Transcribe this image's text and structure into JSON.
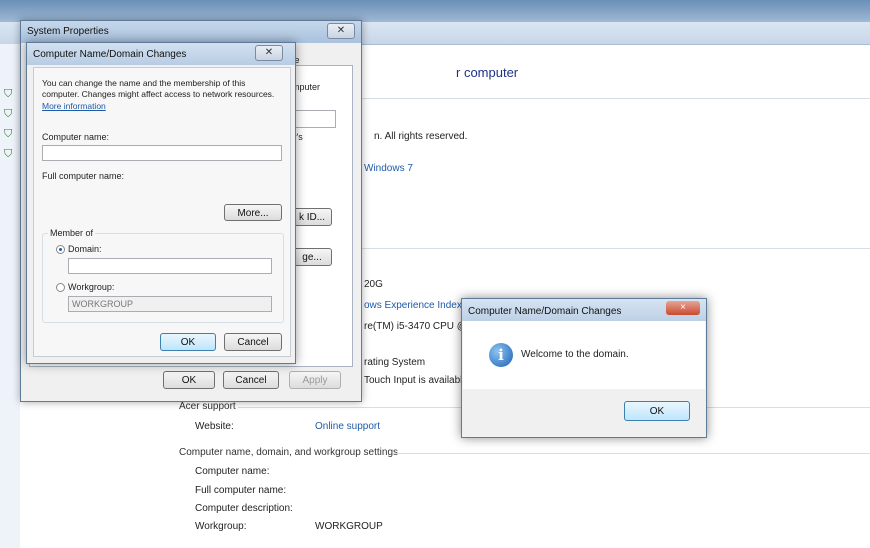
{
  "background": {
    "heading": "r computer",
    "copyright": "n.  All rights reserved.",
    "windows7_link": "Windows 7",
    "processor_line_1": "20G",
    "experience_index_link": "ows Experience Index",
    "processor_line_2": "re(TM) i5-3470 CPU @ 3",
    "os_type": "rating System",
    "touch_input": "Touch Input is available",
    "acer_support_title": "Acer support",
    "website_label": "Website:",
    "website_link": "Online support",
    "name_section_title": "Computer name, domain, and workgroup settings",
    "rows": [
      {
        "label": "Computer name:",
        "value": ""
      },
      {
        "label": "Full computer name:",
        "value": ""
      },
      {
        "label": "Computer description:",
        "value": ""
      },
      {
        "label": "Workgroup:",
        "value": "WORKGROUP"
      }
    ]
  },
  "system_properties": {
    "title": "System Properties",
    "tab_fragment": "ote",
    "panel_text": {
      "computer": "mputer",
      "ys": "y's",
      "network_id_button": "k ID...",
      "change_button": "ge..."
    },
    "buttons": {
      "ok": "OK",
      "cancel": "Cancel",
      "apply": "Apply"
    }
  },
  "name_dialog": {
    "title": "Computer Name/Domain Changes",
    "description": "You can change the name and the membership of this computer. Changes might affect access to network resources.",
    "more_info_link": "More information",
    "computer_name_label": "Computer name:",
    "computer_name_value": "",
    "full_name_label": "Full computer name:",
    "more_button": "More...",
    "member_of_label": "Member of",
    "domain_label": "Domain:",
    "domain_value": "",
    "workgroup_label": "Workgroup:",
    "workgroup_value": "WORKGROUP",
    "ok": "OK",
    "cancel": "Cancel"
  },
  "welcome_dialog": {
    "title": "Computer Name/Domain Changes",
    "close": "×",
    "message": "Welcome to the            domain.",
    "ok": "OK",
    "icon": "info-icon"
  }
}
